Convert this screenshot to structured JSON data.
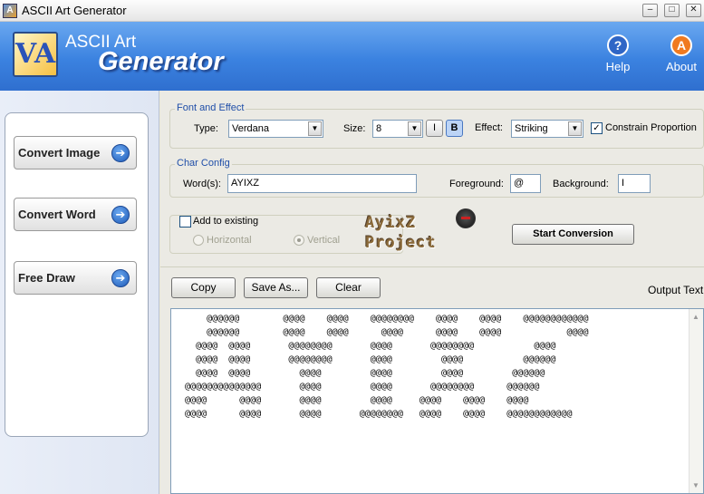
{
  "window": {
    "title": "ASCII Art Generator",
    "minimize_glyph": "‒",
    "maximize_glyph": "□",
    "close_glyph": "✕"
  },
  "header": {
    "logo_text": "VA",
    "title_line1": "ASCII Art",
    "title_line2": "Generator",
    "help_label": "Help",
    "help_glyph": "?",
    "about_label": "About",
    "about_glyph": "A"
  },
  "sidebar": {
    "items": [
      {
        "label": "Convert Image",
        "icon": "arrow-right-icon"
      },
      {
        "label": "Convert Word",
        "icon": "arrow-right-icon"
      },
      {
        "label": "Free Draw",
        "icon": "arrow-right-icon"
      }
    ],
    "arrow_glyph": "➔"
  },
  "font_effect": {
    "legend": "Font and Effect",
    "type_label": "Type:",
    "type_value": "Verdana",
    "size_label": "Size:",
    "size_value": "8",
    "italic_label": "I",
    "bold_label": "B",
    "bold_active": true,
    "effect_label": "Effect:",
    "effect_value": "Striking",
    "constrain_label": "Constrain Proportion",
    "constrain_checked": true,
    "check_glyph": "✓",
    "dropdown_glyph": "▼"
  },
  "char_config": {
    "legend": "Char Config",
    "words_label": "Word(s):",
    "words_value": "AYIXZ",
    "foreground_label": "Foreground:",
    "foreground_value": "@",
    "background_label": "Background:",
    "background_value": "I"
  },
  "add_existing": {
    "label": "Add to existing",
    "checked": false,
    "horizontal_label": "Horizontal",
    "vertical_label": "Vertical",
    "selected": "Vertical"
  },
  "watermark": {
    "line1": "AyixZ",
    "line2": "Project"
  },
  "actions": {
    "start_label": "Start Conversion",
    "copy_label": "Copy",
    "save_label": "Save As...",
    "clear_label": "Clear",
    "output_label": "Output Text"
  },
  "output": {
    "text": "      @@@@@@        @@@@    @@@@    @@@@@@@@    @@@@    @@@@    @@@@@@@@@@@@\n      @@@@@@        @@@@    @@@@      @@@@      @@@@    @@@@            @@@@\n    @@@@  @@@@       @@@@@@@@       @@@@       @@@@@@@@           @@@@\n    @@@@  @@@@       @@@@@@@@       @@@@         @@@@           @@@@@@\n    @@@@  @@@@         @@@@         @@@@         @@@@         @@@@@@\n  @@@@@@@@@@@@@@       @@@@         @@@@       @@@@@@@@      @@@@@@\n  @@@@      @@@@       @@@@         @@@@     @@@@    @@@@    @@@@\n  @@@@      @@@@       @@@@       @@@@@@@@   @@@@    @@@@    @@@@@@@@@@@@"
  }
}
